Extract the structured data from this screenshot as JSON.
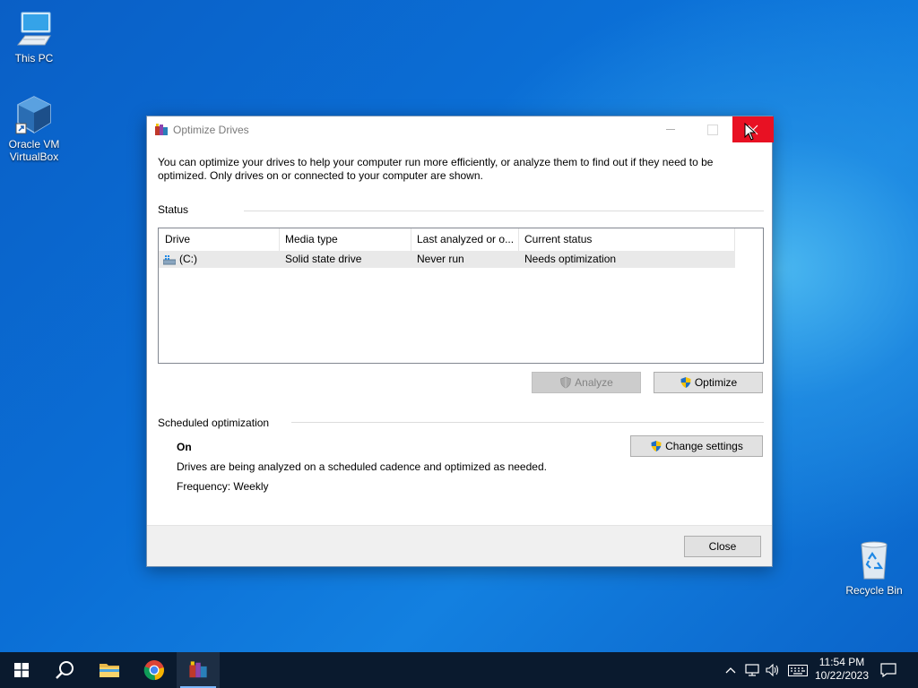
{
  "desktop": {
    "icons": [
      {
        "label": "This PC",
        "icon": "computer-icon"
      },
      {
        "label": "Oracle VM VirtualBox",
        "icon": "virtualbox-icon"
      },
      {
        "label": "Recycle Bin",
        "icon": "recycle-bin-icon"
      }
    ]
  },
  "window": {
    "title": "Optimize Drives",
    "description": "You can optimize your drives to help your computer run more efficiently, or analyze them to find out if they need to be optimized. Only drives on or connected to your computer are shown.",
    "status_label": "Status",
    "columns": [
      "Drive",
      "Media type",
      "Last analyzed or o...",
      "Current status"
    ],
    "drives": [
      {
        "drive": "(C:)",
        "media_type": "Solid state drive",
        "last_analyzed": "Never run",
        "status": "Needs optimization"
      }
    ],
    "analyze_label": "Analyze",
    "optimize_label": "Optimize",
    "scheduled_label": "Scheduled optimization",
    "scheduled_state": "On",
    "scheduled_description": "Drives are being analyzed on a scheduled cadence and optimized as needed.",
    "frequency": "Frequency: Weekly",
    "change_settings_label": "Change settings",
    "close_label": "Close"
  },
  "taskbar": {
    "apps": [
      "start-icon",
      "search-icon",
      "file-explorer-icon",
      "chrome-icon",
      "optimize-drives-icon"
    ],
    "time": "11:54 PM",
    "date": "10/22/2023"
  },
  "colors": {
    "close_hover": "#e81123",
    "taskbar": "#0a1a2e",
    "desktop_blue": "#0b6fd6"
  }
}
